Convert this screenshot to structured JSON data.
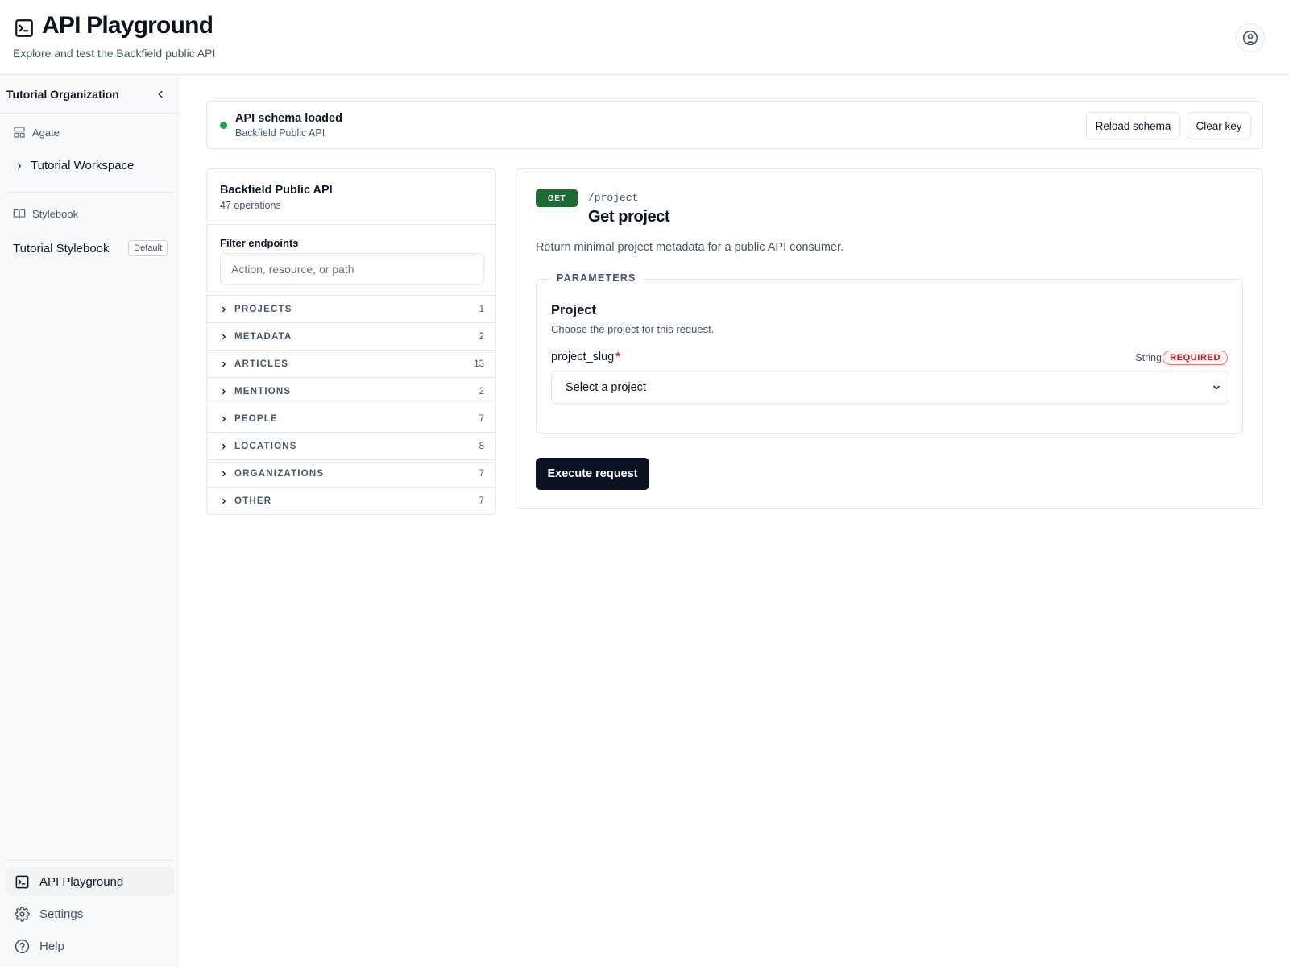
{
  "header": {
    "title": "API Playground",
    "subtitle": "Explore and test the Backfield public API"
  },
  "sidebar": {
    "org_name": "Tutorial Organization",
    "agate_label": "Agate",
    "workspace_label": "Tutorial Workspace",
    "stylebook_section": "Stylebook",
    "stylebook_name": "Tutorial Stylebook",
    "stylebook_badge": "Default",
    "nav": [
      {
        "label": "API Playground"
      },
      {
        "label": "Settings"
      },
      {
        "label": "Help"
      }
    ]
  },
  "status": {
    "title": "API schema loaded",
    "subtitle": "Backfield Public API",
    "reload_label": "Reload schema",
    "clear_label": "Clear key"
  },
  "endpoints": {
    "title": "Backfield Public API",
    "count": "47 operations",
    "filter_label": "Filter endpoints",
    "filter_placeholder": "Action, resource, or path",
    "groups": [
      {
        "label": "PROJECTS",
        "count": "1"
      },
      {
        "label": "METADATA",
        "count": "2"
      },
      {
        "label": "ARTICLES",
        "count": "13"
      },
      {
        "label": "MENTIONS",
        "count": "2"
      },
      {
        "label": "PEOPLE",
        "count": "7"
      },
      {
        "label": "LOCATIONS",
        "count": "8"
      },
      {
        "label": "ORGANIZATIONS",
        "count": "7"
      },
      {
        "label": "OTHER",
        "count": "7"
      }
    ]
  },
  "operation": {
    "method": "GET",
    "path": "/project",
    "title": "Get project",
    "description": "Return minimal project metadata for a public API consumer.",
    "params_legend": "PARAMETERS",
    "param_group_title": "Project",
    "param_group_sub": "Choose the project for this request.",
    "field_name": "project_slug",
    "field_required_mark": "*",
    "field_type": "String",
    "field_required_badge": "REQUIRED",
    "select_value": "Select a project",
    "execute_label": "Execute request"
  },
  "colors": {
    "accent_dark": "#0b1220",
    "method_get": "#1f6b35",
    "status_ok": "#16a34a",
    "required": "#b91c1c"
  }
}
